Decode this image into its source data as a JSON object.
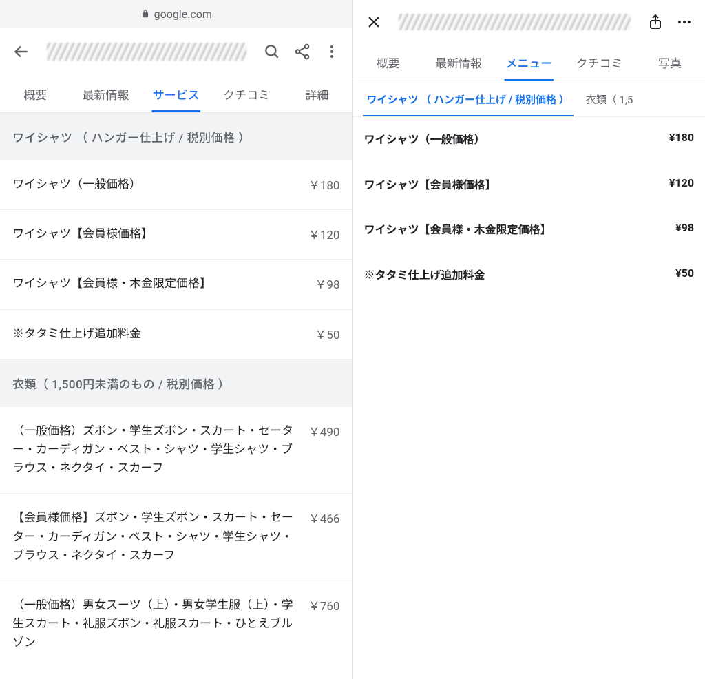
{
  "left": {
    "address_bar": {
      "domain": "google.com"
    },
    "tabs": [
      {
        "label": "概要",
        "active": false
      },
      {
        "label": "最新情報",
        "active": false
      },
      {
        "label": "サービス",
        "active": true
      },
      {
        "label": "クチコミ",
        "active": false
      },
      {
        "label": "詳細",
        "active": false
      }
    ],
    "sections": [
      {
        "header": "ワイシャツ （ ハンガー仕上げ / 税別価格 ）",
        "items": [
          {
            "name": "ワイシャツ（一般価格）",
            "price": "￥180"
          },
          {
            "name": "ワイシャツ【会員様価格】",
            "price": "￥120"
          },
          {
            "name": "ワイシャツ【会員様・木金限定価格】",
            "price": "￥98"
          },
          {
            "name": "※タタミ仕上げ追加料金",
            "price": "￥50"
          }
        ]
      },
      {
        "header": "衣類（ 1,500円未満のもの / 税別価格 ）",
        "items": [
          {
            "name": "（一般価格）ズボン・学生ズボン・スカート・セーター・カーディガン・ベスト・シャツ・学生シャツ・ブラウス・ネクタイ・スカーフ",
            "price": "￥490"
          },
          {
            "name": "【会員様価格】ズボン・学生ズボン・スカート・セーター・カーディガン・ベスト・シャツ・学生シャツ・ブラウス・ネクタイ・スカーフ",
            "price": "￥466"
          },
          {
            "name": "（一般価格）男女スーツ（上）・男女学生服（上）・学生スカート・礼服ズボン・礼服スカート・ひとえブルゾン",
            "price": "￥760"
          }
        ]
      }
    ]
  },
  "right": {
    "tabs": [
      {
        "label": "概要",
        "active": false
      },
      {
        "label": "最新情報",
        "active": false
      },
      {
        "label": "メニュー",
        "active": true
      },
      {
        "label": "クチコミ",
        "active": false
      },
      {
        "label": "写真",
        "active": false
      }
    ],
    "chips": [
      {
        "label": "ワイシャツ （ ハンガー仕上げ / 税別価格 ）",
        "active": true
      },
      {
        "label": "衣類（ 1,5",
        "active": false
      }
    ],
    "items": [
      {
        "name": "ワイシャツ（一般価格）",
        "price": "¥180"
      },
      {
        "name": "ワイシャツ【会員様価格】",
        "price": "¥120"
      },
      {
        "name": "ワイシャツ【会員様・木金限定価格】",
        "price": "¥98"
      },
      {
        "name": "※タタミ仕上げ追加料金",
        "price": "¥50"
      }
    ]
  }
}
